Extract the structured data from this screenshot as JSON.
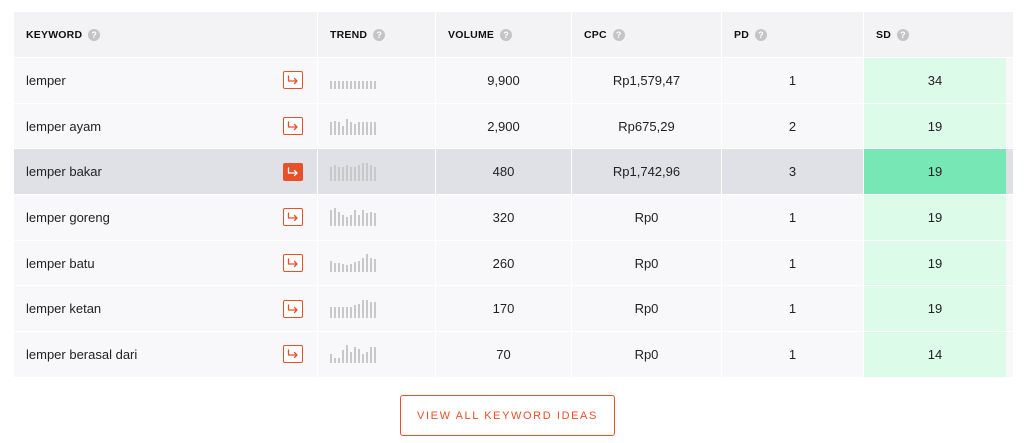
{
  "columns": {
    "keyword": "KEYWORD",
    "trend": "TREND",
    "volume": "VOLUME",
    "cpc": "CPC",
    "pd": "PD",
    "sd": "SD"
  },
  "help_glyph": "?",
  "rows": [
    {
      "keyword": "lemper",
      "volume": "9,900",
      "cpc": "Rp1,579,47",
      "pd": "1",
      "sd": "34",
      "trend": [
        0.45,
        0.45,
        0.45,
        0.45,
        0.45,
        0.45,
        0.45,
        0.45,
        0.45,
        0.45,
        0.45,
        0.45
      ]
    },
    {
      "keyword": "lemper ayam",
      "volume": "2,900",
      "cpc": "Rp675,29",
      "pd": "2",
      "sd": "19",
      "trend": [
        0.7,
        0.8,
        0.7,
        0.5,
        0.9,
        0.7,
        0.6,
        0.7,
        0.7,
        0.7,
        0.7,
        0.7
      ]
    },
    {
      "keyword": "lemper bakar",
      "volume": "480",
      "cpc": "Rp1,742,96",
      "pd": "3",
      "sd": "19",
      "trend": [
        0.8,
        0.9,
        0.8,
        0.8,
        0.9,
        0.8,
        0.8,
        0.9,
        1.0,
        1.0,
        0.9,
        0.8
      ]
    },
    {
      "keyword": "lemper goreng",
      "volume": "320",
      "cpc": "Rp0",
      "pd": "1",
      "sd": "19",
      "trend": [
        0.9,
        1.0,
        0.8,
        0.6,
        0.5,
        0.6,
        0.9,
        0.6,
        0.9,
        0.7,
        0.8,
        0.7
      ]
    },
    {
      "keyword": "lemper batu",
      "volume": "260",
      "cpc": "Rp0",
      "pd": "1",
      "sd": "19",
      "trend": [
        0.6,
        0.5,
        0.5,
        0.45,
        0.4,
        0.45,
        0.55,
        0.6,
        0.8,
        1.0,
        0.8,
        0.7
      ]
    },
    {
      "keyword": "lemper ketan",
      "volume": "170",
      "cpc": "Rp0",
      "pd": "1",
      "sd": "19",
      "trend": [
        0.6,
        0.6,
        0.6,
        0.6,
        0.6,
        0.6,
        0.7,
        0.8,
        1.0,
        1.0,
        0.9,
        0.9
      ]
    },
    {
      "keyword": "lemper berasal dari",
      "volume": "70",
      "cpc": "Rp0",
      "pd": "1",
      "sd": "14",
      "trend": [
        0.5,
        0.3,
        0.3,
        0.7,
        1.0,
        0.6,
        0.9,
        0.8,
        0.5,
        0.6,
        0.9,
        0.9
      ]
    }
  ],
  "highlight_row": 2,
  "cta_label": "VIEW ALL KEYWORD IDEAS",
  "colors": {
    "accent": "#e8502a",
    "sd_bg": "#dcfbe9",
    "sd_highlight": "#77e8b5",
    "spark": "#c8c8c8"
  }
}
